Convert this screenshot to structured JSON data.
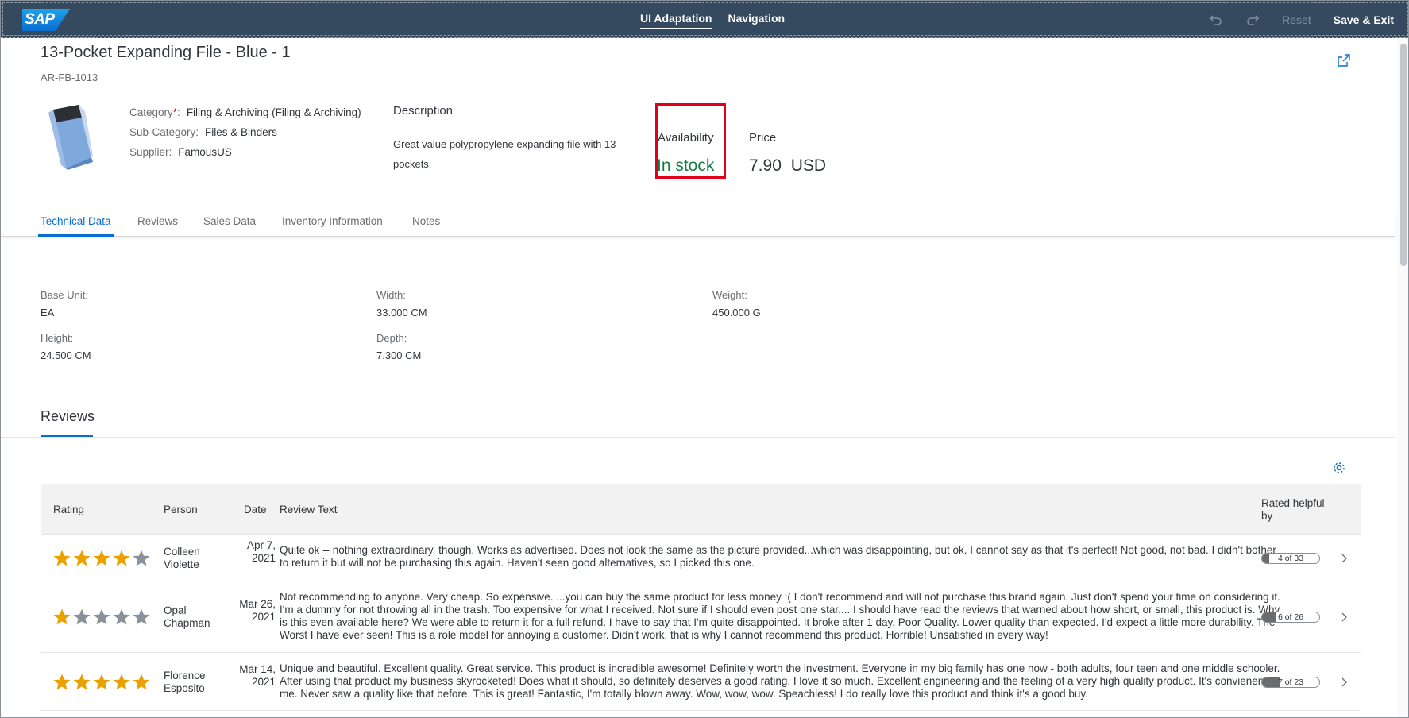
{
  "shell": {
    "logo": "SAP",
    "tabs": [
      "UI Adaptation",
      "Navigation"
    ],
    "reset_label": "Reset",
    "save_exit_label": "Save & Exit"
  },
  "header": {
    "title": "13-Pocket Expanding File - Blue - 1",
    "subtitle": "AR-FB-1013",
    "category_label": "Category",
    "category_required": "*",
    "category_value": "Filing & Archiving (Filing & Archiving)",
    "subcategory_label": "Sub-Category:",
    "subcategory_value": "Files & Binders",
    "supplier_label": "Supplier:",
    "supplier_value": "FamousUS",
    "description_title": "Description",
    "description_text": "Great value polypropylene expanding file with 13 pockets.",
    "availability_label": "Availability",
    "availability_value": "In stock",
    "price_label": "Price",
    "price_value": "7.90 USD"
  },
  "tabs": [
    "Technical Data",
    "Reviews",
    "Sales Data",
    "Inventory Information",
    "Notes"
  ],
  "technical": {
    "base_unit_label": "Base Unit:",
    "base_unit_value": "EA",
    "width_label": "Width:",
    "width_value": "33.000 CM",
    "weight_label": "Weight:",
    "weight_value": "450.000 G",
    "height_label": "Height:",
    "height_value": "24.500 CM",
    "depth_label": "Depth:",
    "depth_value": "7.300 CM"
  },
  "reviews": {
    "heading": "Reviews",
    "columns": [
      "Rating",
      "Person",
      "Date",
      "Review Text",
      "Rated helpful by"
    ],
    "rows": [
      {
        "rating": 4,
        "person": "Colleen Violette",
        "date": "Apr 7, 2021",
        "text": "Quite ok -- nothing extraordinary, though. Works as advertised. Does not look the same as the picture provided...which was disappointing, but ok. I cannot say as that it's perfect! Not good, not bad. I didn't bother to return it but will not be purchasing this again. Haven't seen good alternatives, so I picked this one.",
        "helpful": "4 of 33",
        "helpful_fraction": 0.121
      },
      {
        "rating": 1,
        "person": "Opal Chapman",
        "date": "Mar 26, 2021",
        "text": "Not recommending to anyone. Very cheap. So expensive. ...you can buy the same product for less money :( I don't recommend and will not purchase this brand again. Just don't spend your time on considering it. I'm a dummy for not throwing all in the trash. Too expensive for what I received. Not sure if I should even post one star.... I should have read the reviews that warned about how short, or small, this product is. Why is this even available here? We were able to return it for a full refund. I have to say that I'm quite disappointed. It broke after 1 day. Poor Quality. Lower quality than expected. I'd expect a little more durability. The Worst I have ever seen! This is a role model for annoying a customer. Didn't work, that is why I cannot recommend this product. Horrible! Unsatisfied in every way!",
        "helpful": "6 of 26",
        "helpful_fraction": 0.231
      },
      {
        "rating": 5,
        "person": "Florence Esposito",
        "date": "Mar 14, 2021",
        "text": "Unique and beautiful. Excellent quality. Great service. This product is incredible awesome! Definitely worth the investment. Everyone in my big family has one now - both adults, four teen and one middle schooler. After using that product my business skyrocketed! Does what it should, so definitely deserves a good rating. I love it so much. Excellent engineering and the feeling of a very high quality product. It's convienent for me. Never saw a quality like that before. This is great! Fantastic, I'm totally blown away. Wow, wow, wow. Speachless! I do really love this product and think it's a good buy.",
        "helpful": "7 of 23",
        "helpful_fraction": 0.304
      }
    ]
  },
  "colors": {
    "shell_bg": "#354a5f",
    "accent": "#0a6ed1",
    "positive": "#107e3e",
    "star_filled": "#e8a100",
    "star_empty": "#89919a",
    "highlight_box": "#e0001b"
  }
}
